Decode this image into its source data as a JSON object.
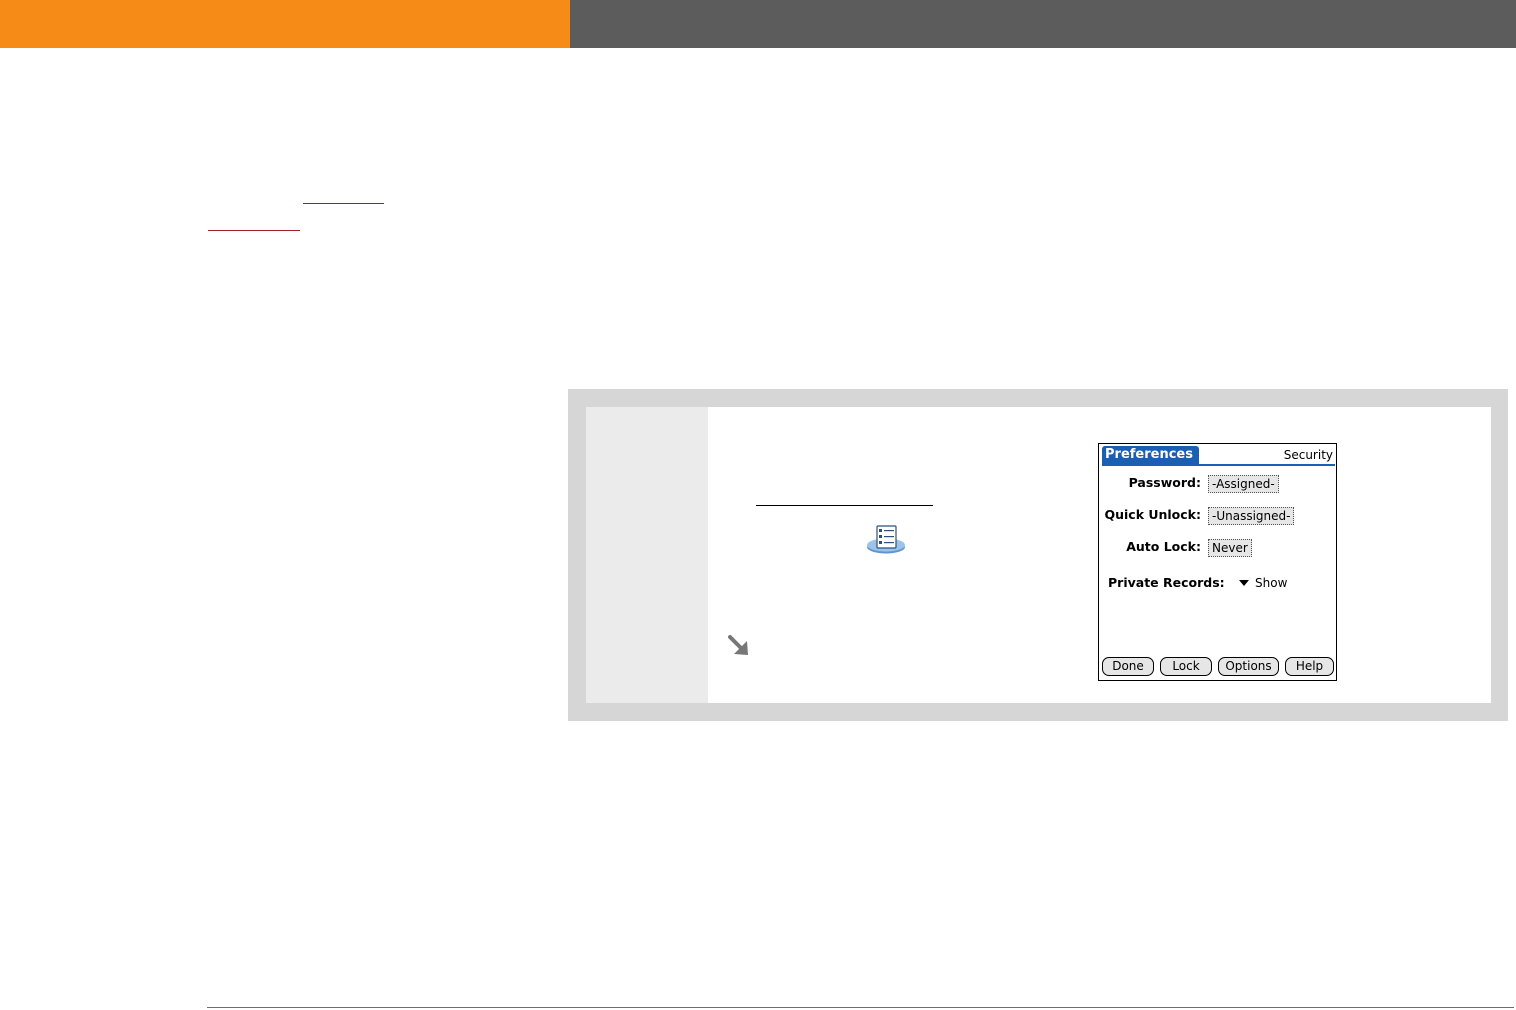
{
  "header": {
    "left_color": "#F78B17",
    "right_color": "#5C5C5C"
  },
  "links": {
    "color": "#A31E2B"
  },
  "icons": {
    "preferences": "preferences-app-icon",
    "tip": "tip-arrow-icon"
  },
  "palm_screen": {
    "title": "Preferences",
    "section": "Security",
    "accent": "#1A5FB4",
    "fields": [
      {
        "label": "Password:",
        "value": "-Assigned-"
      },
      {
        "label": "Quick Unlock:",
        "value": "-Unassigned-"
      },
      {
        "label": "Auto Lock:",
        "value": "Never"
      }
    ],
    "private_records": {
      "label": "Private Records:",
      "value": "Show"
    },
    "buttons": [
      "Done",
      "Lock",
      "Options",
      "Help"
    ]
  }
}
